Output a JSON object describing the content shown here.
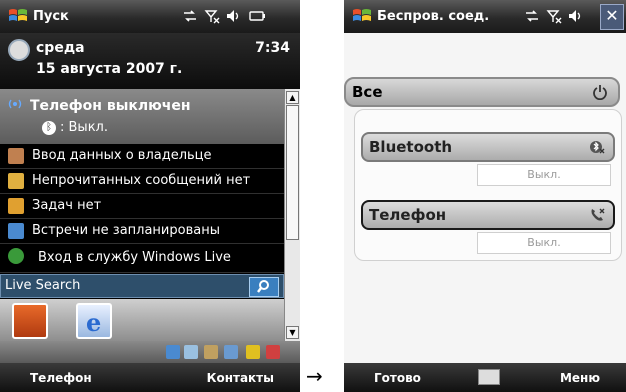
{
  "left_screen": {
    "titlebar": {
      "title": "Пуск"
    },
    "date_block": {
      "day": "среда",
      "date": "15 августа 2007 г.",
      "time": "7:34"
    },
    "phone": {
      "title": "Телефон выключен",
      "bluetooth_state": ": Выкл."
    },
    "items": [
      {
        "label": "Ввод данных о владельце",
        "icon": "owner-icon",
        "color": "#c08050"
      },
      {
        "label": "Непрочитанных сообщений нет",
        "icon": "envelope-icon",
        "color": "#e0b040"
      },
      {
        "label": "Задач нет",
        "icon": "tasks-icon",
        "color": "#e0a030"
      },
      {
        "label": "Встречи не запланированы",
        "icon": "calendar-icon",
        "color": "#4a8ad0"
      },
      {
        "label": "Вход в службу Windows Live",
        "icon": "windows-live-icon",
        "color": "#3a9a3a"
      }
    ],
    "search": {
      "label": "Live Search"
    },
    "softkeys": {
      "left": "Телефон",
      "right": "Контакты"
    }
  },
  "right_screen": {
    "titlebar": {
      "title": "Беспров. соед."
    },
    "all_row": {
      "label": "Все"
    },
    "devices": [
      {
        "label": "Bluetooth",
        "state": "Выкл.",
        "icon": "bluetooth-icon"
      },
      {
        "label": "Телефон",
        "state": "Выкл.",
        "icon": "phone-icon"
      }
    ],
    "softkeys": {
      "left": "Готово",
      "right": "Меню"
    }
  },
  "arrow": "→"
}
